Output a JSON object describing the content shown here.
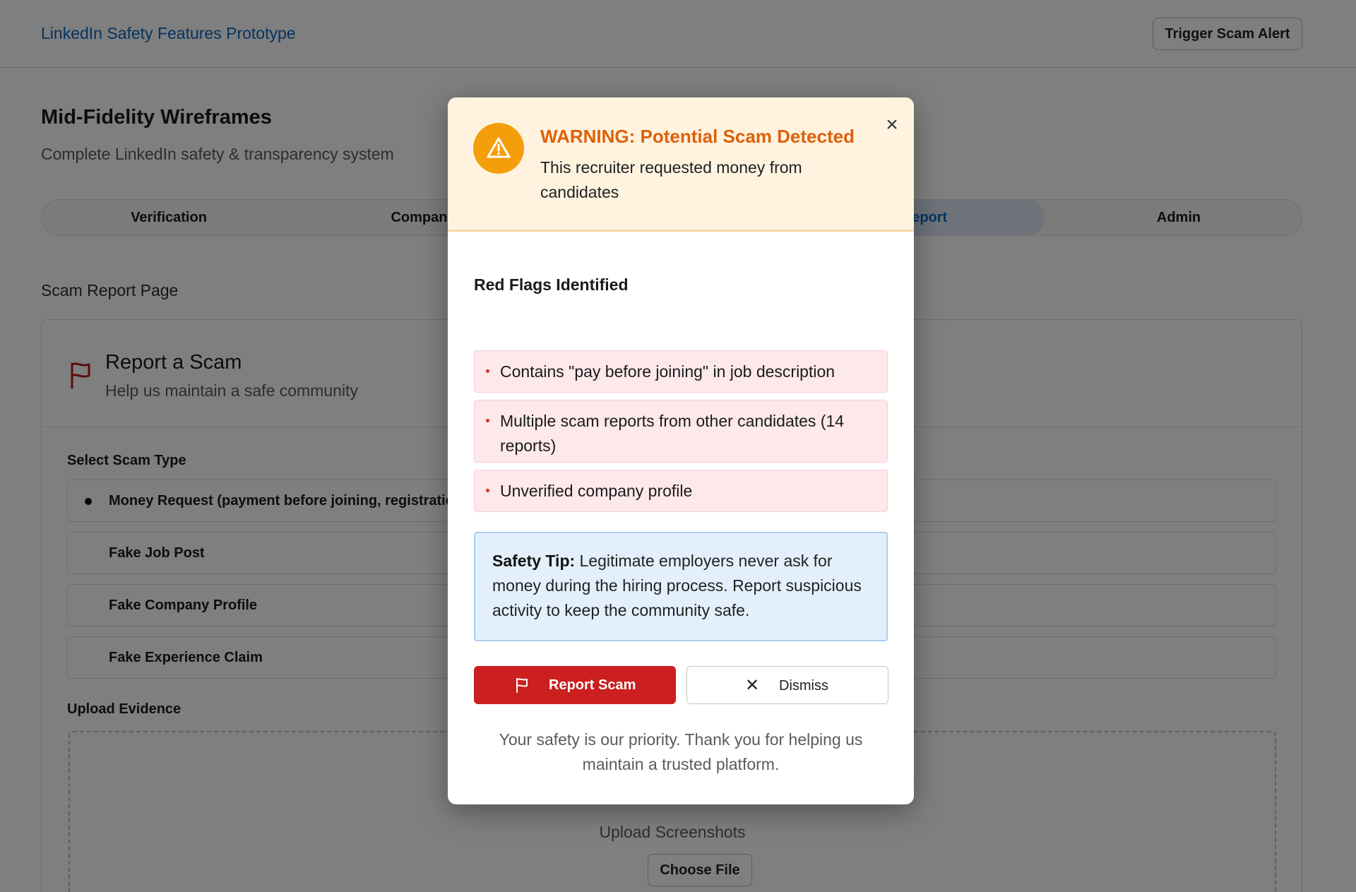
{
  "app": {
    "title": "LinkedIn Safety Features Prototype",
    "trigger_label": "Trigger Scam Alert"
  },
  "page": {
    "title": "Mid-Fidelity Wireframes",
    "subtitle": "Complete LinkedIn safety & transparency system"
  },
  "tabs": [
    {
      "label": "Verification",
      "active": false
    },
    {
      "label": "Company",
      "active": false
    },
    {
      "label": "Report",
      "active": true
    },
    {
      "label": "Admin",
      "active": false
    }
  ],
  "section_label": "Scam Report Page",
  "report_card": {
    "icon": "flag-icon",
    "title": "Report a Scam",
    "subtitle": "Help us maintain a safe community",
    "scam_type_label": "Select Scam Type",
    "options": [
      {
        "label": "Money Request (payment before joining, registratic",
        "selected": true
      },
      {
        "label": "Fake Job Post",
        "selected": false
      },
      {
        "label": "Fake Company Profile",
        "selected": false
      },
      {
        "label": "Fake Experience Claim",
        "selected": false
      }
    ],
    "upload_label": "Upload Evidence",
    "upload_hint": "Upload Screenshots",
    "choose_file_label": "Choose File"
  },
  "modal": {
    "icon": "warning-icon",
    "close_icon": "close-icon",
    "close_glyph": "×",
    "title": "WARNING: Potential Scam Detected",
    "description": "This recruiter requested money from candidates",
    "red_flags_title": "Red Flags Identified",
    "red_flags": [
      "Contains \"pay before joining\" in job description",
      "Multiple scam reports from other candidates (14 reports)",
      "Unverified company profile"
    ],
    "safety_tip": {
      "label": "Safety Tip:",
      "text": "Legitimate employers never ask for money during the hiring process. Report suspicious activity to keep the community safe."
    },
    "report_button": "Report Scam",
    "dismiss_button": "Dismiss",
    "dismiss_glyph": "✕",
    "footer": "Your safety is our priority. Thank you for helping us maintain a trusted platform."
  },
  "colors": {
    "brand": "#0a66c2",
    "warning": "#f59e0b",
    "warning_text": "#e0600a",
    "danger": "#cc1f1f",
    "flag_bg": "#fde8ea",
    "tip_bg": "#e3f0fc"
  }
}
